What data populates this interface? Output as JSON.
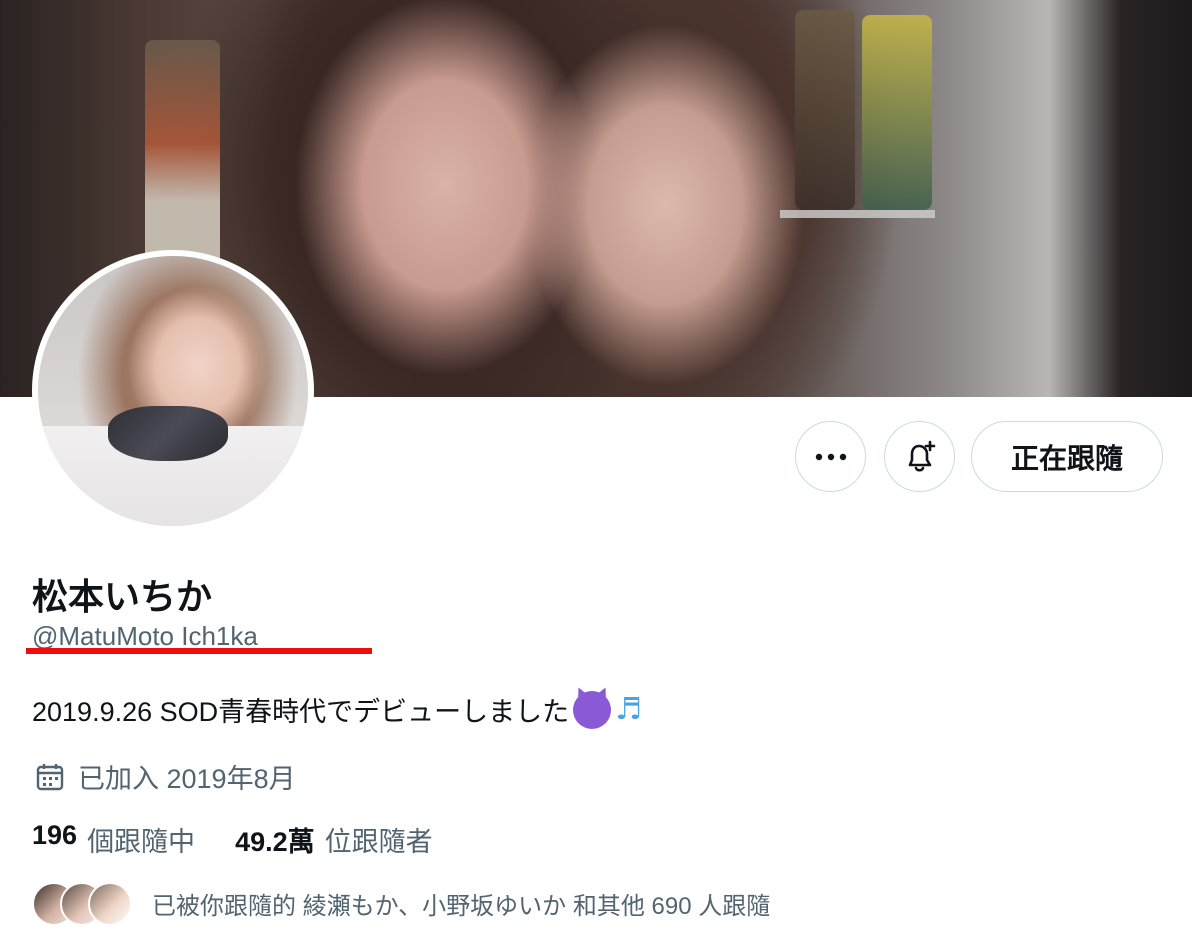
{
  "profile": {
    "name": "松本いちか",
    "handle": "@MatuMoto Ich1ka",
    "bio": "2019.9.26 SOD青春時代でデビューしました",
    "joined": "已加入 2019年8月"
  },
  "actions": {
    "follow_label": "正在跟隨"
  },
  "stats": {
    "following_count": "196",
    "following_label": "個跟隨中",
    "followers_count": "49.2萬",
    "followers_label": "位跟隨者"
  },
  "followed_by": {
    "text": "已被你跟隨的 綾瀬もか、小野坂ゆいか 和其他 690 人跟隨"
  },
  "icons": {
    "more": "more-horizontal-icon",
    "notify": "bell-plus-icon",
    "calendar": "calendar-icon",
    "bio_emoji_1": "smiling-devil-emoji",
    "bio_emoji_2": "musical-notes-emoji"
  },
  "colors": {
    "underline": "#f00c0c",
    "secondary_text": "#536471",
    "primary_text": "#0f1419",
    "border": "#cfd9de"
  }
}
